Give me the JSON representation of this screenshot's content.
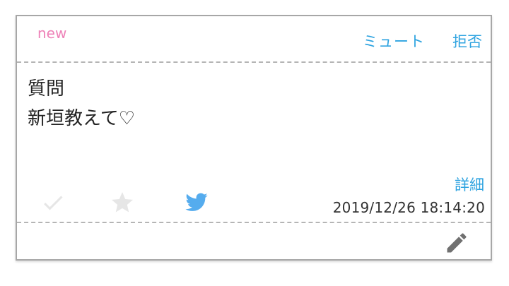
{
  "header": {
    "new_label": "new",
    "mute_label": "ミュート",
    "reject_label": "拒否"
  },
  "question": {
    "lines": [
      "質問",
      "新垣教えて♡"
    ]
  },
  "actions": {
    "icons": [
      "check-icon",
      "star-icon",
      "twitter-icon"
    ],
    "detail_label": "詳細",
    "timestamp": "2019/12/26 18:14:20"
  },
  "footer": {
    "icon": "pencil-icon"
  },
  "colors": {
    "accent": "#2ea3e0",
    "new_badge": "#ee82b8",
    "icon_disabled": "#e6e6e6",
    "twitter": "#55acee",
    "pencil": "#707070"
  }
}
